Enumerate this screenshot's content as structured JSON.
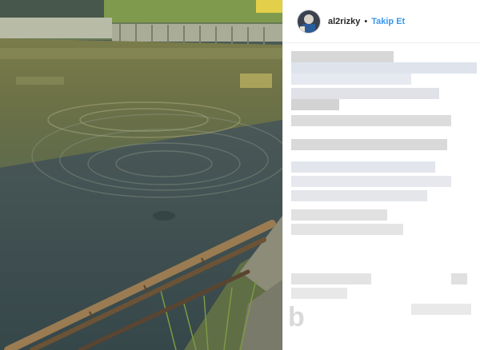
{
  "post": {
    "media": {
      "description_icon": "video-frame",
      "colors": {
        "water_upper": "#6d7447",
        "water_lower": "#3f4e4f",
        "bamboo": "#8a6a45",
        "grass": "#5e7a3c"
      }
    },
    "header": {
      "username": "al2rizky",
      "separator": "•",
      "follow_label": "Takip Et",
      "follow_color": "#3897f0"
    },
    "caption": {
      "state": "pixelated",
      "lines": 13
    },
    "watermark": {
      "text": "b",
      "color": "#aaaaaa"
    }
  }
}
